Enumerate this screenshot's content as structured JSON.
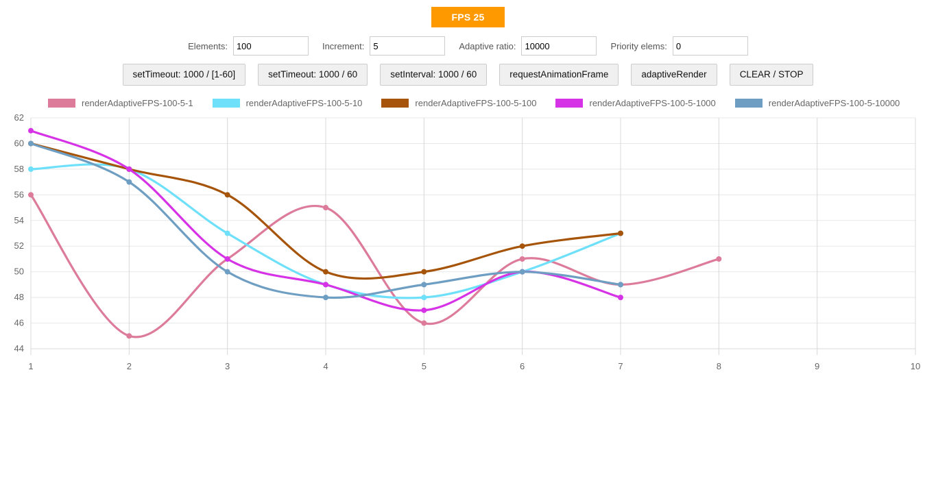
{
  "fps": {
    "label": "FPS 25",
    "color": "#ff9900"
  },
  "controls": {
    "fields": [
      {
        "name": "elements",
        "label": "Elements:",
        "value": "100",
        "placeholder": ""
      },
      {
        "name": "increment",
        "label": "Increment:",
        "value": "5",
        "placeholder": ""
      },
      {
        "name": "adaptive-ratio",
        "label": "Adaptive ratio:",
        "value": "10000",
        "placeholder": ""
      },
      {
        "name": "priority-elems",
        "label": "Priority elems:",
        "value": "0",
        "placeholder": ""
      }
    ],
    "buttons": [
      {
        "name": "set-timeout-range",
        "label": "setTimeout: 1000 / [1-60]"
      },
      {
        "name": "set-timeout-60",
        "label": "setTimeout: 1000 / 60"
      },
      {
        "name": "set-interval-60",
        "label": "setInterval: 1000 / 60"
      },
      {
        "name": "request-animation-frame",
        "label": "requestAnimationFrame"
      },
      {
        "name": "adaptive-render",
        "label": "adaptiveRender"
      },
      {
        "name": "clear-stop",
        "label": "CLEAR / STOP"
      }
    ]
  },
  "chart_data": {
    "type": "line",
    "title": "",
    "xlabel": "",
    "ylabel": "",
    "xlim": [
      1,
      10
    ],
    "ylim": [
      44,
      62
    ],
    "xticks": [
      1,
      2,
      3,
      4,
      5,
      6,
      7,
      8,
      9,
      10
    ],
    "yticks": [
      44,
      46,
      48,
      50,
      52,
      54,
      56,
      58,
      60,
      62
    ],
    "grid": true,
    "legend_position": "top",
    "smooth": true,
    "series": [
      {
        "name": "renderAdaptiveFPS-100-5-1",
        "color": "#dd7b9b",
        "x": [
          1,
          2,
          3,
          4,
          5,
          6,
          7,
          8
        ],
        "values": [
          56,
          45,
          51,
          55,
          46,
          51,
          49,
          51
        ]
      },
      {
        "name": "renderAdaptiveFPS-100-5-10",
        "color": "#6fe0fa",
        "x": [
          1,
          2,
          3,
          4,
          5,
          6,
          7
        ],
        "values": [
          58,
          58,
          53,
          49,
          48,
          50,
          53
        ]
      },
      {
        "name": "renderAdaptiveFPS-100-5-100",
        "color": "#a5540a",
        "x": [
          1,
          2,
          3,
          4,
          5,
          6,
          7
        ],
        "values": [
          60,
          58,
          56,
          50,
          50,
          52,
          53
        ]
      },
      {
        "name": "renderAdaptiveFPS-100-5-1000",
        "color": "#d633e6",
        "x": [
          1,
          2,
          3,
          4,
          5,
          6,
          7
        ],
        "values": [
          61,
          58,
          51,
          49,
          47,
          50,
          48
        ]
      },
      {
        "name": "renderAdaptiveFPS-100-5-10000",
        "color": "#6f9ec3",
        "x": [
          1,
          2,
          3,
          4,
          5,
          6,
          7
        ],
        "values": [
          60,
          57,
          50,
          48,
          49,
          50,
          49
        ]
      }
    ]
  }
}
